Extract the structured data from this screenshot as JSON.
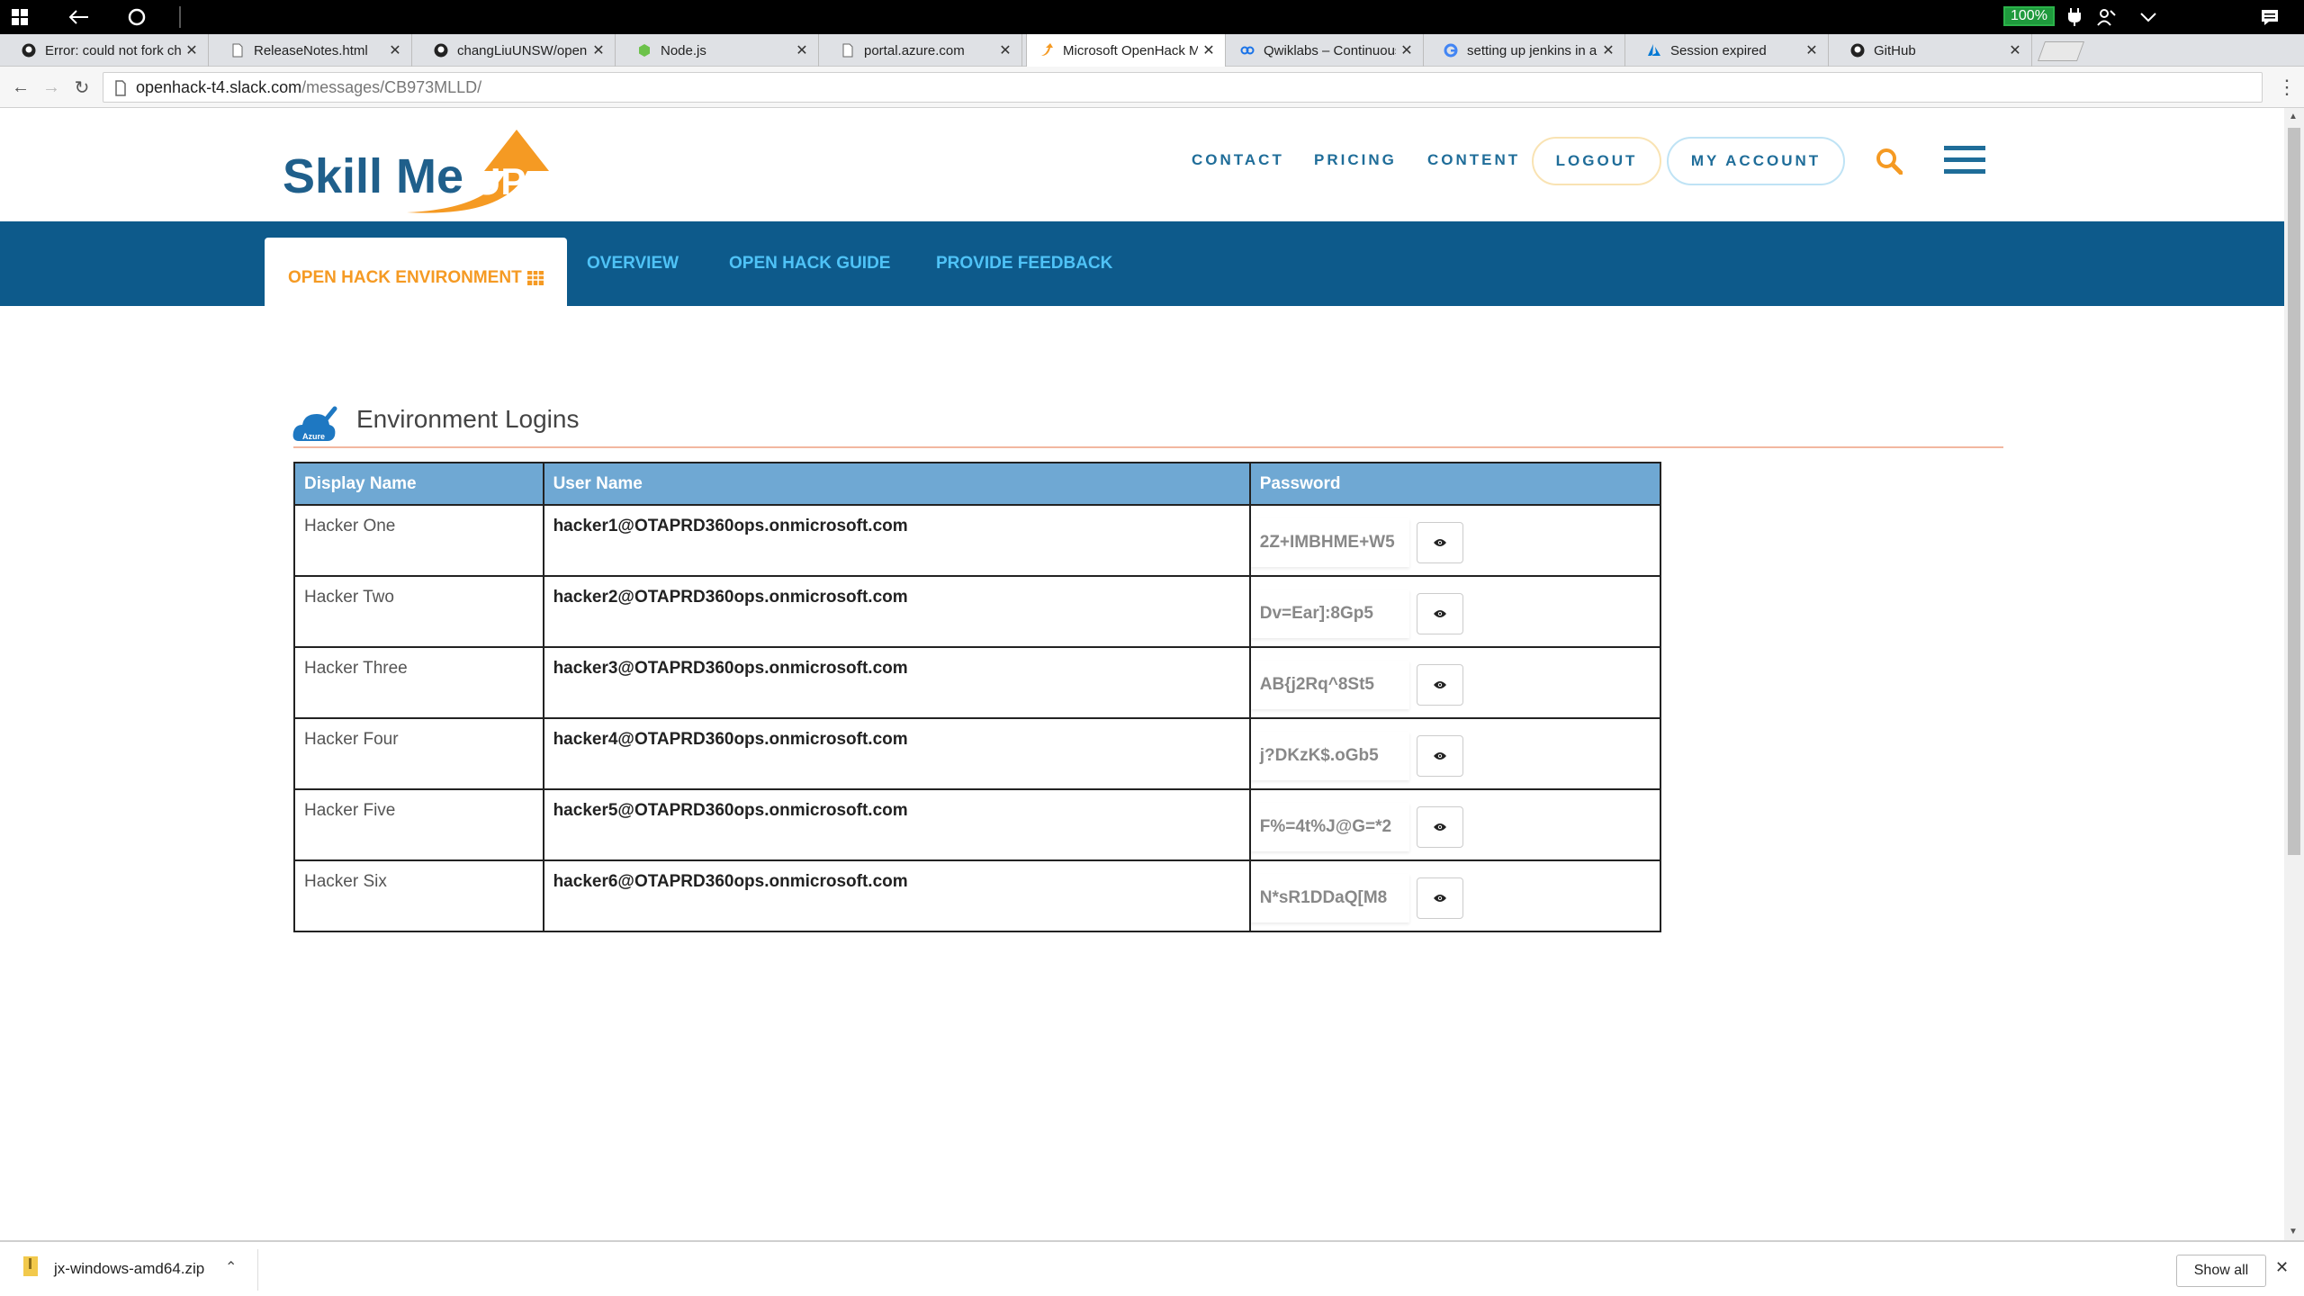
{
  "taskbar": {
    "battery": "100%"
  },
  "tabs": [
    {
      "title": "Error: could not fork ch",
      "icon": "github-icon"
    },
    {
      "title": "ReleaseNotes.html",
      "icon": "page-icon"
    },
    {
      "title": "changLiuUNSW/openh",
      "icon": "github-icon"
    },
    {
      "title": "Node.js",
      "icon": "nodejs-icon"
    },
    {
      "title": "portal.azure.com",
      "icon": "page-icon"
    },
    {
      "title": "Microsoft OpenHack M",
      "icon": "skillmeup-icon"
    },
    {
      "title": "Qwiklabs – Continuous",
      "icon": "qwiklabs-icon"
    },
    {
      "title": "setting up jenkins in a",
      "icon": "google-icon"
    },
    {
      "title": "Session expired",
      "icon": "azure-icon"
    },
    {
      "title": "GitHub",
      "icon": "github-icon"
    }
  ],
  "address": {
    "host": "openhack-t4.slack.com",
    "path": "/messages/CB973MLLD/"
  },
  "site": {
    "logo_text": "Skill Me",
    "logo_up": "UP",
    "nav": {
      "contact": "CONTACT",
      "pricing": "PRICING",
      "content": "CONTENT",
      "logout": "LOGOUT",
      "my_account": "MY ACCOUNT"
    },
    "subnav": {
      "env": "OPEN HACK ENVIRONMENT",
      "overview": "OVERVIEW",
      "guide": "OPEN HACK GUIDE",
      "feedback": "PROVIDE FEEDBACK"
    }
  },
  "section": {
    "title": "Environment Logins",
    "azure_badge": "Azure"
  },
  "table": {
    "headers": [
      "Display Name",
      "User Name",
      "Password"
    ],
    "rows": [
      {
        "display": "Hacker One",
        "user": "hacker1@OTAPRD360ops.onmicrosoft.com",
        "password": "2Z+IMBHME+W5"
      },
      {
        "display": "Hacker Two",
        "user": "hacker2@OTAPRD360ops.onmicrosoft.com",
        "password": "Dv=Ear]:8Gp5"
      },
      {
        "display": "Hacker Three",
        "user": "hacker3@OTAPRD360ops.onmicrosoft.com",
        "password": "AB{j2Rq^8St5"
      },
      {
        "display": "Hacker Four",
        "user": "hacker4@OTAPRD360ops.onmicrosoft.com",
        "password": "j?DKzK$.oGb5"
      },
      {
        "display": "Hacker Five",
        "user": "hacker5@OTAPRD360ops.onmicrosoft.com",
        "password": "F%=4t%J@G=*2"
      },
      {
        "display": "Hacker Six",
        "user": "hacker6@OTAPRD360ops.onmicrosoft.com",
        "password": "N*sR1DDaQ[M8"
      }
    ]
  },
  "downloads": {
    "file": "jx-windows-amd64.zip",
    "show_all": "Show all"
  },
  "colors": {
    "brand_blue": "#0d5a8b",
    "accent_orange": "#f59a23",
    "link_cyan": "#4fc3f7",
    "table_header": "#6fa8d3"
  }
}
